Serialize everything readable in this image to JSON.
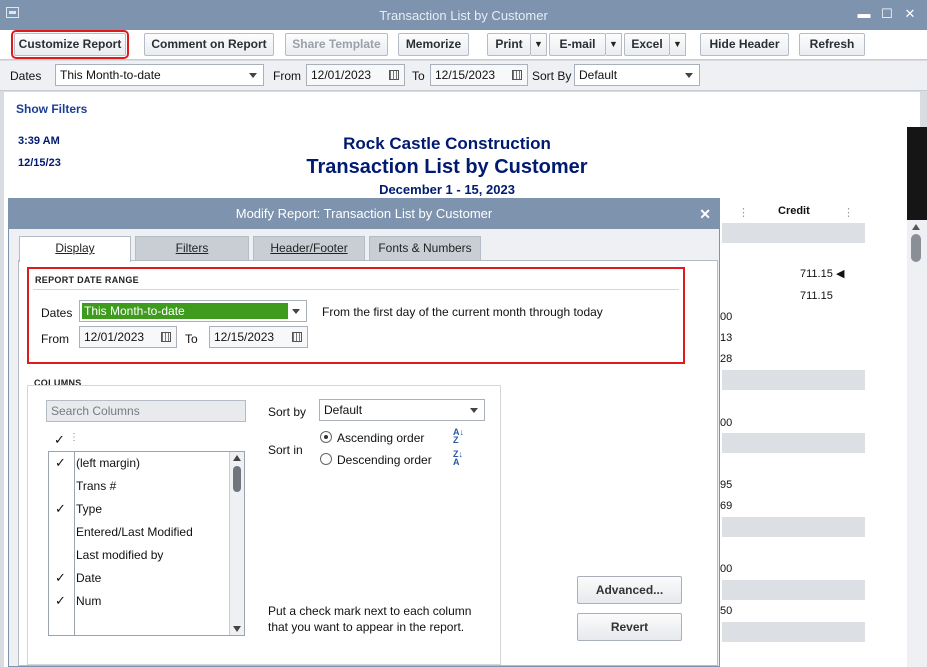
{
  "window": {
    "title": "Transaction List by Customer"
  },
  "toolbar": {
    "customize": "Customize Report",
    "comment": "Comment on Report",
    "share": "Share Template",
    "memorize": "Memorize",
    "print": "Print",
    "email": "E-mail",
    "excel": "Excel",
    "hide_header": "Hide Header",
    "refresh": "Refresh"
  },
  "filters": {
    "dates_label": "Dates",
    "dates_value": "This Month-to-date",
    "from_label": "From",
    "from_value": "12/01/2023",
    "to_label": "To",
    "to_value": "12/15/2023",
    "sortby_label": "Sort By",
    "sortby_value": "Default"
  },
  "report": {
    "show_filters": "Show Filters",
    "time": "3:39 AM",
    "date": "12/15/23",
    "company": "Rock Castle Construction",
    "title": "Transaction List by Customer",
    "range": "December 1 - 15, 2023",
    "credit_header": "Credit",
    "credit_values": [
      "711.15",
      "711.15"
    ],
    "partial_cells": [
      "00",
      "13",
      "28",
      "00",
      "95",
      "69",
      "00",
      "50"
    ]
  },
  "dialog": {
    "title": "Modify Report: Transaction List by Customer",
    "tabs": [
      "Display",
      "Filters",
      "Header/Footer",
      "Fonts & Numbers"
    ],
    "date_range": {
      "section": "REPORT DATE RANGE",
      "dates_label": "Dates",
      "dates_value": "This Month-to-date",
      "description": "From the first day of the current month through today",
      "from_label": "From",
      "from_value": "12/01/2023",
      "to_label": "To",
      "to_value": "12/15/2023"
    },
    "columns": {
      "section": "COLUMNS",
      "search_placeholder": "Search Columns",
      "header_check": "✓",
      "items": [
        {
          "checked": true,
          "label": "(left margin)"
        },
        {
          "checked": false,
          "label": "Trans #"
        },
        {
          "checked": true,
          "label": "Type"
        },
        {
          "checked": false,
          "label": "Entered/Last Modified"
        },
        {
          "checked": false,
          "label": "Last modified by"
        },
        {
          "checked": true,
          "label": "Date"
        },
        {
          "checked": true,
          "label": "Num"
        }
      ],
      "sortby_label": "Sort by",
      "sortby_value": "Default",
      "sortin_label": "Sort in",
      "ascending": "Ascending order",
      "descending": "Descending order",
      "hint": "Put a check mark next to each column that you want to appear in the report."
    },
    "advanced": "Advanced...",
    "revert": "Revert"
  }
}
